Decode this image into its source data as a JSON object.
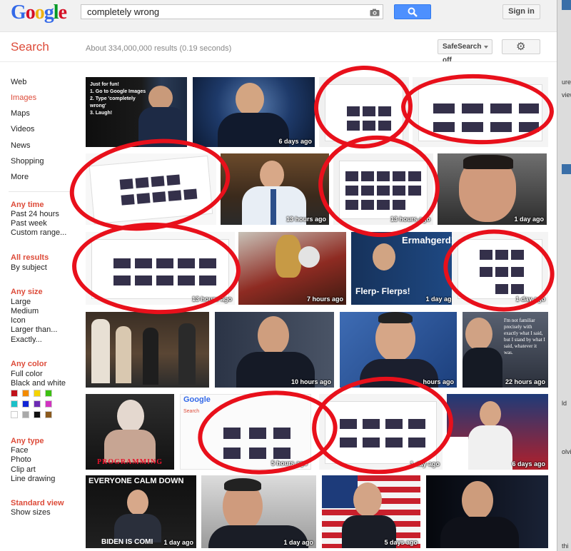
{
  "header": {
    "logo": "Google",
    "query": "completely wrong",
    "signin_label": "Sign in"
  },
  "toolbar": {
    "section_title": "Search",
    "result_stats": "About 334,000,000 results (0.19 seconds)",
    "safesearch_label": "SafeSearch off"
  },
  "sidebar": {
    "nav": [
      "Web",
      "Images",
      "Maps",
      "Videos",
      "News",
      "Shopping",
      "More"
    ],
    "active_nav": "Images",
    "filters": [
      {
        "heading": "Any time",
        "items": [
          "Past 24 hours",
          "Past week",
          "Custom range..."
        ]
      },
      {
        "heading": "All results",
        "items": [
          "By subject"
        ]
      },
      {
        "heading": "Any size",
        "items": [
          "Large",
          "Medium",
          "Icon",
          "Larger than...",
          "Exactly..."
        ]
      },
      {
        "heading": "Any color",
        "items": [
          "Full color",
          "Black and white"
        ]
      },
      {
        "heading": "Any type",
        "items": [
          "Face",
          "Photo",
          "Clip art",
          "Line drawing"
        ]
      },
      {
        "heading": "Standard view",
        "items": [
          "Show sizes"
        ]
      }
    ],
    "swatches": [
      "#c0111a",
      "#f38b00",
      "#f5d400",
      "#3cc112",
      "#1bc0c8",
      "#1125d6",
      "#6c2bb4",
      "#d233c1",
      "#ffffff",
      "#a9a9a9",
      "#111111",
      "#8b5a1e"
    ]
  },
  "thumbs": [
    {
      "caption": "Just for fun!\n1. Go to Google Images\n2. Type 'completely wrong'\n3. Laugh!",
      "time": ""
    },
    {
      "caption": "",
      "time": "6 days ago"
    },
    {
      "caption": "",
      "time": ""
    },
    {
      "caption": "",
      "time": ""
    },
    {
      "caption": "",
      "time": ""
    },
    {
      "caption": "",
      "time": "13 hours ago"
    },
    {
      "caption": "",
      "time": "13 hours ago"
    },
    {
      "caption": "",
      "time": "1 day ago"
    },
    {
      "caption": "",
      "time": "13 hours ago"
    },
    {
      "caption": "",
      "time": "7 hours ago"
    },
    {
      "caption": "Ermahgerd!",
      "caption2": "Flerp- Flerps!",
      "time": "1 day ago"
    },
    {
      "caption": "",
      "time": "1 day ago"
    },
    {
      "caption": "",
      "time": ""
    },
    {
      "caption": "",
      "time": "10 hours ago"
    },
    {
      "caption": "",
      "time": "hours ago"
    },
    {
      "caption": "I'm not familiar precisely with exactly what I said, but I stand by what I said, whatever it was.",
      "time": "22 hours ago"
    },
    {
      "caption": "PROGRAMMING",
      "time": ""
    },
    {
      "caption": "",
      "time": "5 hours ago"
    },
    {
      "caption": "",
      "time": "1 day ago"
    },
    {
      "caption": "",
      "time": "6 days ago"
    },
    {
      "caption": "EVERYONE CALM DOWN",
      "caption2": "BIDEN IS COMI",
      "time": "1 day ago"
    },
    {
      "caption": "",
      "time": "1 day ago"
    },
    {
      "caption": "",
      "time": "5 days ago"
    },
    {
      "caption": "",
      "time": ""
    }
  ],
  "right_strip": {
    "labels": [
      "ure",
      "view",
      "ld",
      "olvi",
      "thi"
    ]
  },
  "colors": {
    "accent": "#dd4b39",
    "button_blue": "#4d90fe",
    "circle_red": "#e8101b"
  },
  "icons": [
    "search-icon",
    "camera-icon",
    "gear-icon",
    "chevron-down-icon"
  ]
}
